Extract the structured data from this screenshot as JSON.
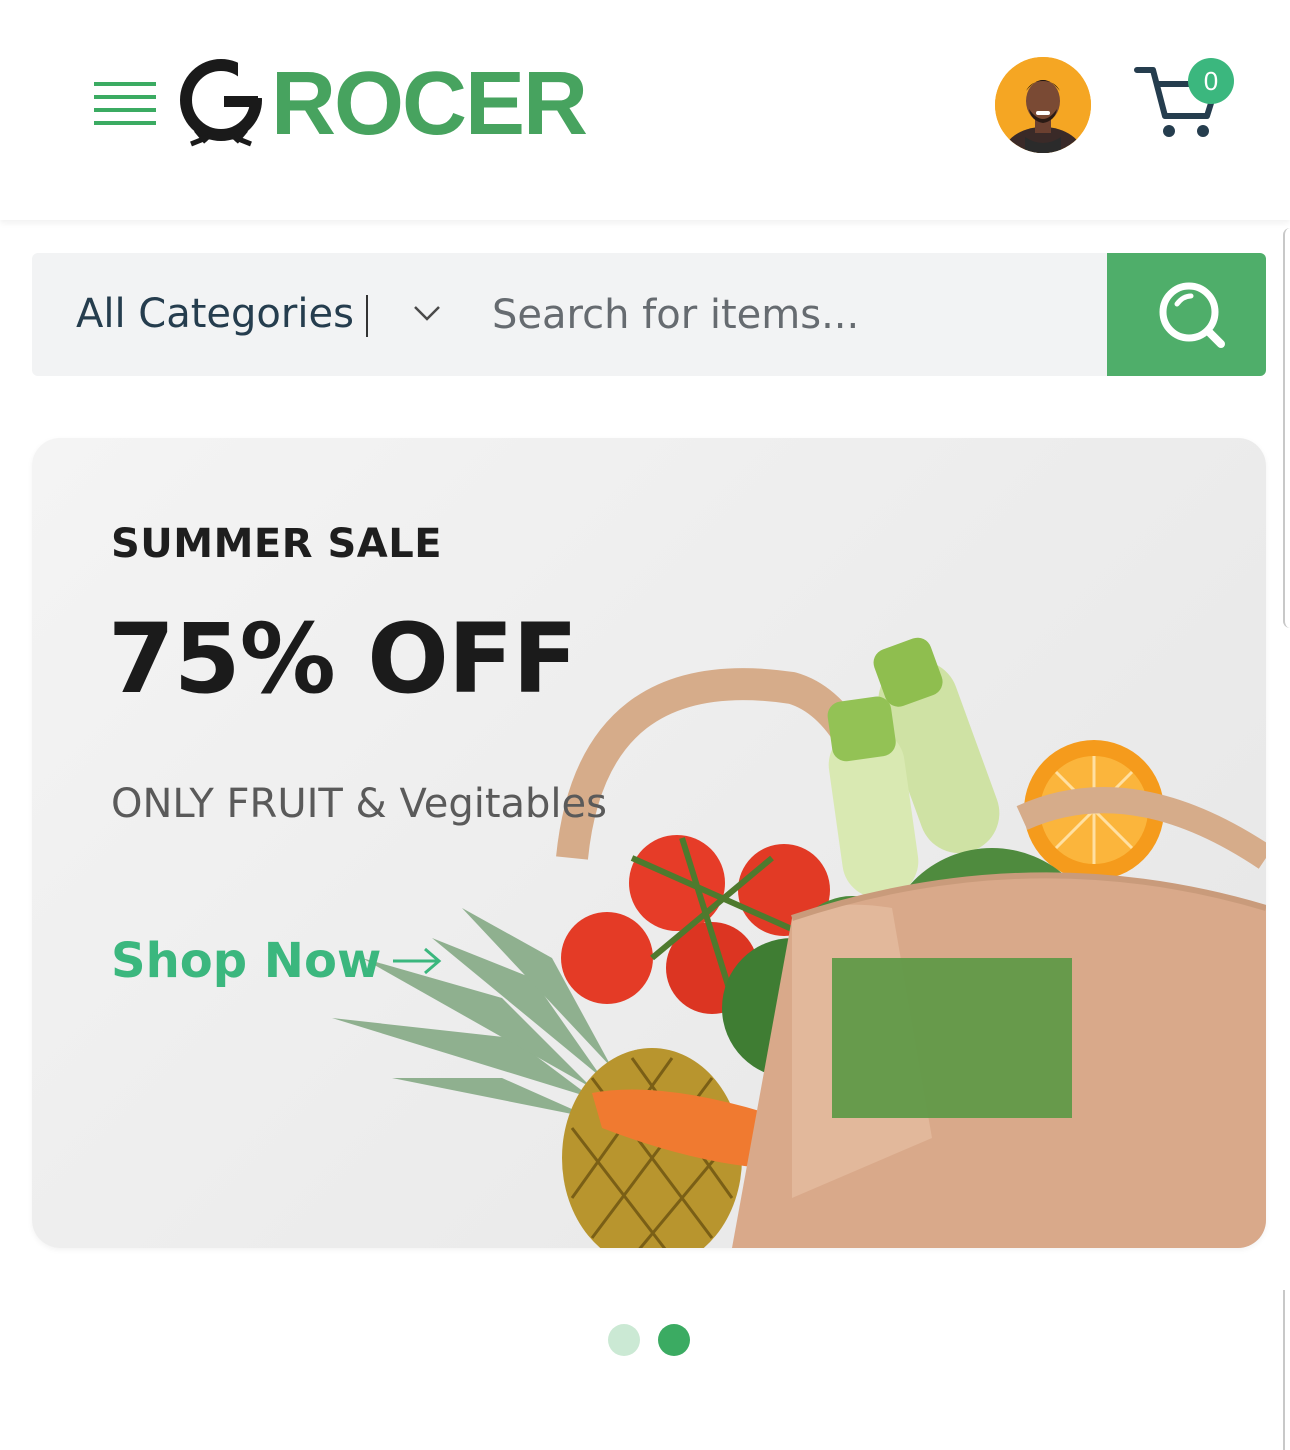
{
  "header": {
    "menu_icon": "hamburger-icon",
    "logo_text": "GROCER",
    "avatar_icon": "user-avatar",
    "cart_icon": "shopping-cart-icon",
    "cart_count": "0"
  },
  "search": {
    "category_label": "All Categories",
    "placeholder": "Search for items...",
    "button_icon": "search-icon"
  },
  "banner": {
    "eyebrow": "SUMMER SALE",
    "title": "75% OFF",
    "subtitle": "ONLY FRUIT & Vegitables",
    "cta_label": "Shop Now",
    "cta_icon": "arrow-right-icon",
    "image": "grocery-bag-illustration"
  },
  "carousel": {
    "slide_count": 2,
    "active_index": 2
  },
  "colors": {
    "brand_green": "#3bb77e",
    "button_green": "#4fae6a",
    "dark_text": "#253d4e",
    "badge": "#3bb77e"
  }
}
